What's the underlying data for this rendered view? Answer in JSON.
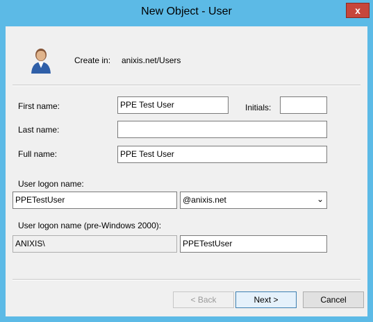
{
  "window": {
    "title": "New Object - User",
    "close_label": "x"
  },
  "header": {
    "create_in_label": "Create in:",
    "create_in_value": "anixis.net/Users"
  },
  "form": {
    "first_name_label": "First name:",
    "first_name_value": "PPE Test User",
    "initials_label": "Initials:",
    "initials_value": "",
    "last_name_label": "Last name:",
    "last_name_value": "",
    "full_name_label": "Full name:",
    "full_name_value": "PPE Test User",
    "logon_name_label": "User logon name:",
    "logon_name_value": "PPETestUser",
    "domain_value": "@anixis.net",
    "pre2000_label": "User logon name (pre-Windows 2000):",
    "pre2000_domain_value": "ANIXIS\\",
    "pre2000_name_value": "PPETestUser"
  },
  "buttons": {
    "back_label": "< Back",
    "next_label": "Next >",
    "cancel_label": "Cancel"
  },
  "colors": {
    "titlebar": "#5cbae6",
    "close": "#c7463b",
    "client": "#f0f0f0"
  }
}
